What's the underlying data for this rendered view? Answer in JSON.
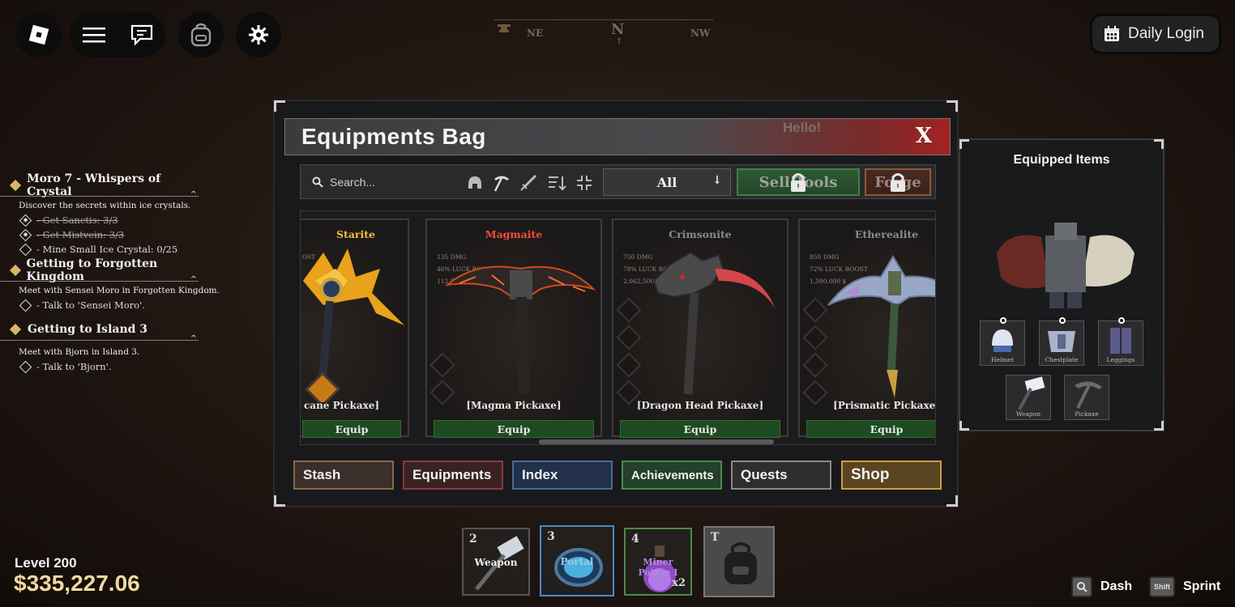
{
  "topbar": {
    "menu_icon": "hamburger-icon",
    "chat_icon": "chat-icon",
    "backpack_icon": "backpack-icon",
    "settings_icon": "gear-icon"
  },
  "compass": {
    "left": "NE",
    "center": "N",
    "right": "NW"
  },
  "daily_login": {
    "label": "Daily Login",
    "icon": "calendar-icon"
  },
  "quests": [
    {
      "title": "Moro 7 - Whispers of Crystal",
      "description": "Discover the secrets within ice crystals.",
      "tasks": [
        {
          "text": "- Get Sanctis: 3/3",
          "done": true
        },
        {
          "text": "- Get Mistvein: 3/3",
          "done": true
        },
        {
          "text": "- Mine Small Ice Crystal: 0/25",
          "done": false
        }
      ]
    },
    {
      "title": "Getting to Forgotten Kingdom",
      "description": "Meet with Sensei Moro in Forgotten Kingdom.",
      "tasks": [
        {
          "text": "- Talk to 'Sensei Moro'.",
          "done": false
        }
      ]
    },
    {
      "title": "Getting to Island 3",
      "description": "Meet with Bjorn in Island 3.",
      "tasks": [
        {
          "text": "- Talk to 'Bjorn'.",
          "done": false
        }
      ]
    }
  ],
  "bag": {
    "title": "Equipments Bag",
    "close_label": "X",
    "hello_text": "Hello!",
    "search_placeholder": "Search...",
    "filter_value": "All",
    "sell_label": "Sell Tools",
    "forge_label": "Forge",
    "equip_label": "Equip",
    "items": [
      {
        "ore": "Starite",
        "ore_color": "#f0c040",
        "stat_dmg": "",
        "stat_luck": "OST",
        "stat_price": "",
        "label": "cane Pickaxe]"
      },
      {
        "ore": "Magmaite",
        "ore_color": "#ff4a3a",
        "stat_dmg": "135 DMG",
        "stat_luck": "46% LUCK BOOST",
        "stat_price": "112,500 $",
        "label": "[Magma Pickaxe]"
      },
      {
        "ore": "Crimsonite",
        "ore_color": "#8b8b8b",
        "stat_dmg": "750 DMG",
        "stat_luck": "78% LUCK BOOST",
        "stat_price": "2,062,500 $",
        "label": "[Dragon Head Pickaxe]"
      },
      {
        "ore": "Etherealite",
        "ore_color": "#8b8b8b",
        "stat_dmg": "850 DMG",
        "stat_luck": "72% LUCK BOOST",
        "stat_price": "1,500,000 $",
        "label": "[Prismatic Pickaxe]"
      }
    ],
    "tabs": [
      "Stash",
      "Equipments",
      "Index",
      "Achievements",
      "Quests",
      "Shop"
    ]
  },
  "equipped": {
    "title": "Equipped Items",
    "slots": [
      "Helmet",
      "Chestplate",
      "Leggings",
      "Weapon",
      "Pickaxe"
    ]
  },
  "hotbar": [
    {
      "key": "2",
      "label": "Weapon",
      "color": "#eeeeee"
    },
    {
      "key": "3",
      "label": "Portal",
      "color": "#9cc8e6"
    },
    {
      "key": "4",
      "label": "Miner Potion I",
      "color": "#b08ae0",
      "count": "x2"
    },
    {
      "key": "T",
      "label": "",
      "color": "#ffffff"
    }
  ],
  "player": {
    "level": "Level 200",
    "money": "$335,227.06"
  },
  "keyhints": [
    {
      "key": "Q",
      "action": "Dash"
    },
    {
      "key": "Shift",
      "action": "Sprint"
    }
  ]
}
